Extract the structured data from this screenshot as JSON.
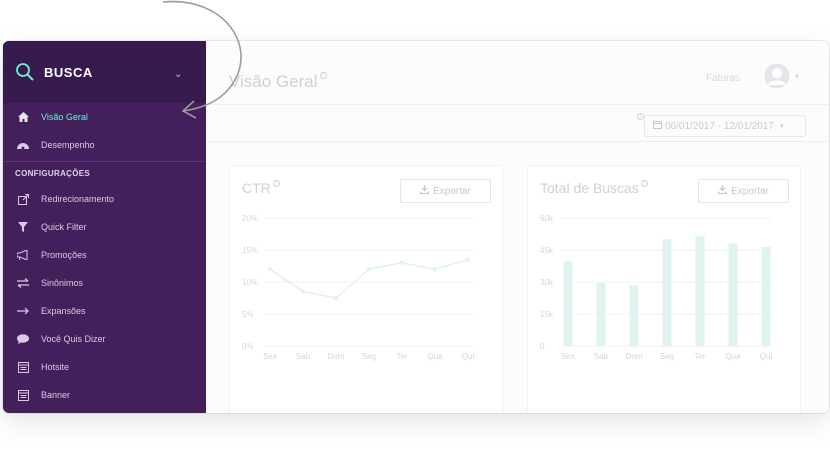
{
  "sidebar": {
    "brand_title": "BUSCA",
    "items_top": [
      {
        "label": "Visão Geral",
        "icon": "home-icon"
      },
      {
        "label": "Desempenho",
        "icon": "dashboard-icon"
      }
    ],
    "section_label": "CONFIGURAÇÕES",
    "items_config": [
      {
        "label": "Redirecionamento",
        "icon": "external-link-icon"
      },
      {
        "label": "Quick Filter",
        "icon": "filter-icon"
      },
      {
        "label": "Promoções",
        "icon": "bullhorn-icon"
      },
      {
        "label": "Sinônimos",
        "icon": "exchange-icon"
      },
      {
        "label": "Expansões",
        "icon": "arrow-right-icon"
      },
      {
        "label": "Você Quis Dizer",
        "icon": "comment-icon"
      },
      {
        "label": "Hotsite",
        "icon": "window-icon"
      },
      {
        "label": "Banner",
        "icon": "window-icon"
      }
    ]
  },
  "header": {
    "page_title": "Visão Geral",
    "faturas": "Faturas"
  },
  "date_range": {
    "value": "06/01/2017 - 12/01/2017"
  },
  "cards": {
    "ctr": {
      "title": "CTR",
      "export_label": "Exportar"
    },
    "total": {
      "title": "Total de Buscas",
      "export_label": "Exportar"
    }
  },
  "colors": {
    "sidebar_bg": "#43205c",
    "brand_bg": "#371a4e",
    "accent": "#6ff0d8",
    "chart_color": "#dff3f0"
  },
  "chart_data": [
    {
      "type": "line",
      "title": "CTR",
      "categories": [
        "Sex",
        "Sab",
        "Dom",
        "Seg",
        "Ter",
        "Qua",
        "Qui"
      ],
      "yticks": [
        "20%",
        "15%",
        "10%",
        "5%",
        "0%"
      ],
      "ylim": [
        0,
        20
      ],
      "values": [
        12,
        8.5,
        7.5,
        12,
        13,
        12,
        13.5
      ]
    },
    {
      "type": "bar",
      "title": "Total de Buscas",
      "categories": [
        "Sex",
        "Sab",
        "Dom",
        "Seg",
        "Ter",
        "Qua",
        "Qui"
      ],
      "yticks": [
        "60k",
        "45k",
        "30k",
        "15k",
        "0"
      ],
      "ylim": [
        0,
        60000
      ],
      "values": [
        40000,
        29500,
        28500,
        50000,
        51500,
        48000,
        46500
      ]
    }
  ]
}
